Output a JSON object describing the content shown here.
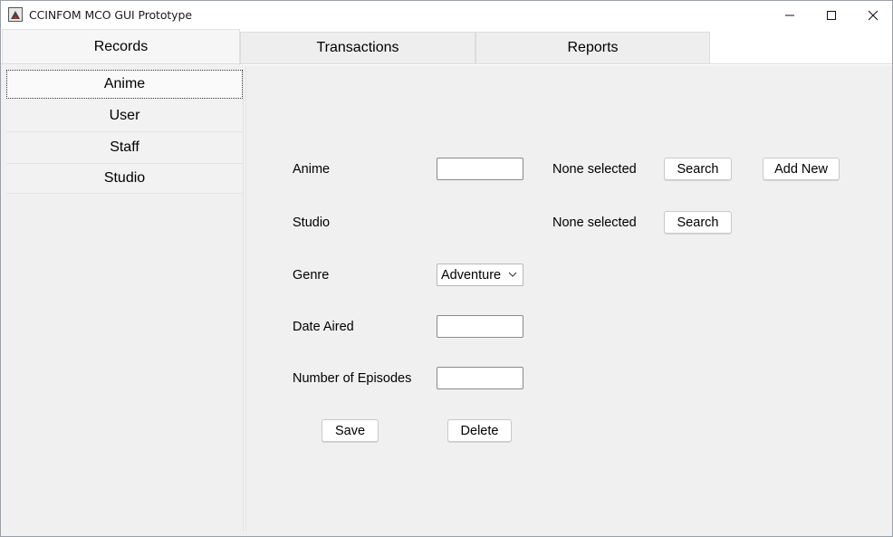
{
  "window": {
    "title": "CCINFOM MCO GUI Prototype"
  },
  "tabs": [
    {
      "label": "Records",
      "active": true
    },
    {
      "label": "Transactions",
      "active": false
    },
    {
      "label": "Reports",
      "active": false
    }
  ],
  "sidebar": {
    "items": [
      {
        "label": "Anime",
        "selected": true
      },
      {
        "label": "User",
        "selected": false
      },
      {
        "label": "Staff",
        "selected": false
      },
      {
        "label": "Studio",
        "selected": false
      }
    ]
  },
  "form": {
    "anime": {
      "label": "Anime",
      "value": "",
      "status": "None selected",
      "search_label": "Search",
      "add_new_label": "Add New"
    },
    "studio": {
      "label": "Studio",
      "status": "None selected",
      "search_label": "Search"
    },
    "genre": {
      "label": "Genre",
      "selected": "Adventure"
    },
    "date_aired": {
      "label": "Date Aired",
      "value": ""
    },
    "episodes": {
      "label": "Number of Episodes",
      "value": ""
    },
    "save_label": "Save",
    "delete_label": "Delete"
  }
}
